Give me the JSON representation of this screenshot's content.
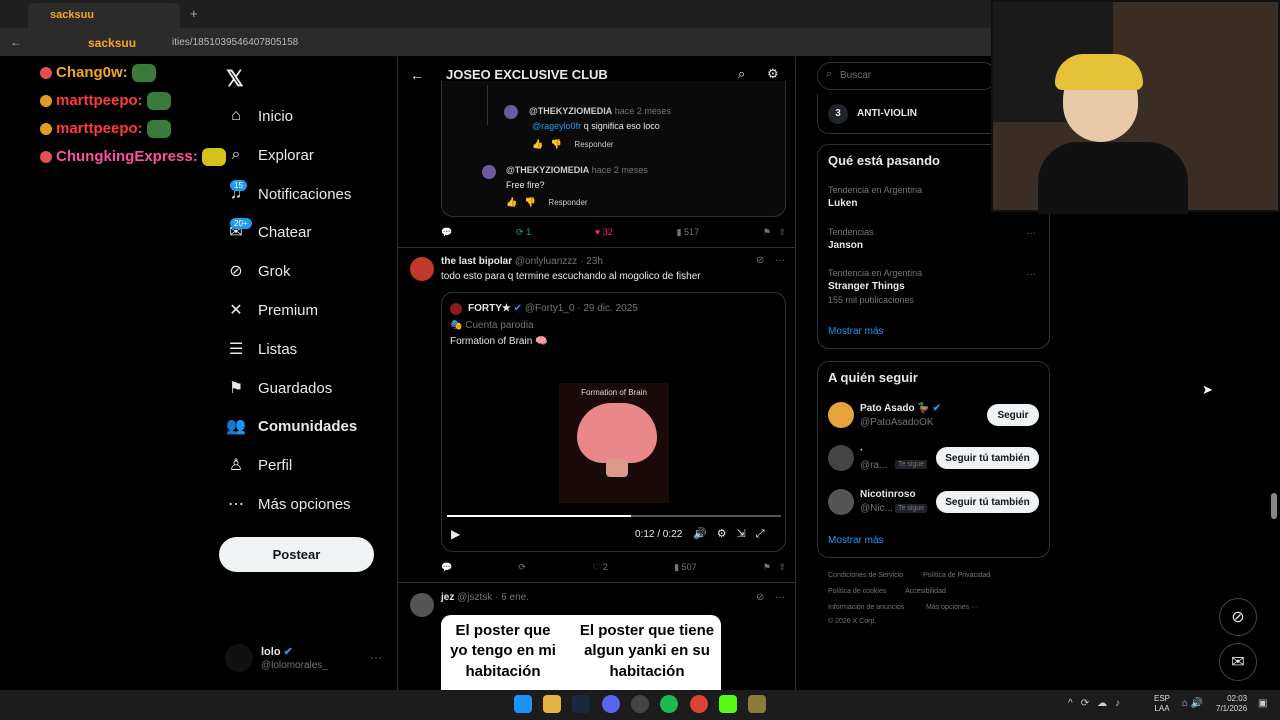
{
  "browser": {
    "tab_title": "sacksuu",
    "url": "/1851039546407805158",
    "url_prefix": "sacksuu",
    "url_mid": "ities"
  },
  "chat": [
    {
      "user": "Chang0w:",
      "color": "#f5a623"
    },
    {
      "user": "marttpeepo:",
      "color": "#ff3b3b"
    },
    {
      "user": "marttpeepo:",
      "color": "#ff3b3b"
    },
    {
      "user": "ChungkingExpress:",
      "color": "#ff4fa3"
    }
  ],
  "nav": {
    "items": [
      {
        "label": "Inicio",
        "icon": "home-icon"
      },
      {
        "label": "Explorar",
        "icon": "search-icon"
      },
      {
        "label": "Notificaciones",
        "icon": "bell-icon",
        "badge": "15"
      },
      {
        "label": "Chatear",
        "icon": "mail-icon",
        "badge": "20+"
      },
      {
        "label": "Grok",
        "icon": "grok-icon"
      },
      {
        "label": "Premium",
        "icon": "x-icon"
      },
      {
        "label": "Listas",
        "icon": "list-icon"
      },
      {
        "label": "Guardados",
        "icon": "bookmark-icon"
      },
      {
        "label": "Comunidades",
        "icon": "people-icon"
      },
      {
        "label": "Perfil",
        "icon": "person-icon"
      },
      {
        "label": "Más opciones",
        "icon": "more-icon"
      }
    ],
    "post_label": "Postear",
    "account_name": "lolo",
    "account_handle": "@lolomorales_"
  },
  "header": {
    "title": "JOSEO EXCLUSIVE CLUB"
  },
  "quoted_thread": {
    "reply1": {
      "user": "@THEKYZIOMEDIA",
      "time": "hace 2 meses",
      "mention": "@rageylo0fr",
      "text": "q significa eso loco",
      "reply": "Responder"
    },
    "reply2": {
      "user": "@THEKYZIOMEDIA",
      "time": "hace 2 meses",
      "text": "Free fire?",
      "reply": "Responder"
    },
    "stats": {
      "retweets": "1",
      "likes": "32",
      "views": "517"
    }
  },
  "post1": {
    "name": "the last bipolar",
    "handle": "@onlyluanzzz",
    "time": "23h",
    "text": "todo esto para q termine escuchando al mogolico de fisher",
    "quote": {
      "name": "FORTY★",
      "handle": "@Forty1_0",
      "date": "29 dic. 2025",
      "label": "Cuenta parodia",
      "text": "Formation of Brain 🧠",
      "video_caption": "Formation of Brain",
      "time": "0:12 / 0:22",
      "progress": 0.55
    },
    "stats": {
      "likes": "2",
      "views": "507"
    }
  },
  "post2": {
    "name": "jez",
    "handle": "@jsztsk",
    "time": "6 ene.",
    "meme_left": "El poster que yo tengo en mi habitación",
    "meme_right": "El poster que tiene algun yanki en su habitación"
  },
  "right": {
    "search_placeholder": "Buscar",
    "top_rank": "3",
    "top_item": "ANTI-VIOLIN",
    "trends_title": "Qué está pasando",
    "trends": [
      {
        "label": "Tendencia en Argentina",
        "name": "Luken",
        "sub": ""
      },
      {
        "label": "Tendencias",
        "name": "Janson",
        "sub": ""
      },
      {
        "label": "Tendencia en Argentina",
        "name": "Stranger Things",
        "sub": "155 mil publicaciones"
      }
    ],
    "show_more": "Mostrar más",
    "follow_title": "A quién seguir",
    "follows": [
      {
        "name": "Pato Asado 🦆",
        "handle": "@PatoAsadoOK",
        "button": "Seguir",
        "follows_you": ""
      },
      {
        "name": "·",
        "handle": "@ra...",
        "button": "Seguir tú también",
        "follows_you": "Te sigue"
      },
      {
        "name": "Nicotinroso",
        "handle": "@Nic...",
        "button": "Seguir tú también",
        "follows_you": "Te sigue"
      }
    ],
    "show_more2": "Mostrar más",
    "footer": [
      "Condiciones de Servicio",
      "Política de Privacidad",
      "Política de cookies",
      "Accesibilidad",
      "Información de anuncios",
      "Más opciones ···",
      "© 2026 X Corp."
    ]
  },
  "taskbar": {
    "lang": "ESP",
    "lang2": "LAA",
    "time": "02:03",
    "date": "7/1/2026"
  }
}
